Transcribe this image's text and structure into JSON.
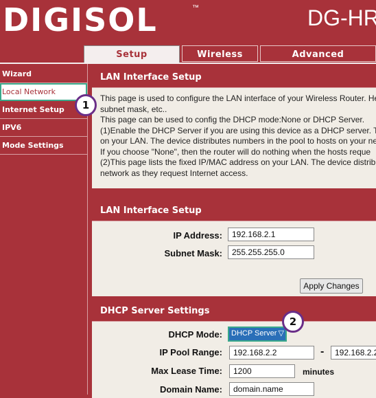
{
  "brand": {
    "logo": "DIGISOL",
    "trademark": "™",
    "model": "DG-HR"
  },
  "tabs": [
    {
      "label": "Setup",
      "active": true
    },
    {
      "label": "Wireless",
      "active": false
    },
    {
      "label": "Advanced",
      "active": false
    }
  ],
  "sidebar": {
    "items": [
      {
        "label": "Wizard"
      },
      {
        "label": "Local Network",
        "selected": true
      },
      {
        "label": "Internet Setup"
      },
      {
        "label": "IPV6"
      },
      {
        "label": "Mode Settings"
      }
    ]
  },
  "intro": {
    "title": "LAN Interface Setup",
    "lines": [
      "This page is used to configure the LAN interface of your Wireless Router. He",
      "subnet mask, etc..",
      "This page can be used to config the DHCP mode:None or DHCP Server.",
      "(1)Enable the DHCP Server if you are using this device as a DHCP server. Th",
      "on your LAN. The device distributes numbers in the pool to hosts on your ne",
      "If you choose \"None\", then the router will do nothing when the hosts reque",
      "(2)This page lists the fixed IP/MAC address on your LAN. The device distribu",
      "network as they request Internet access."
    ]
  },
  "lan": {
    "title": "LAN Interface Setup",
    "ip_label": "IP Address:",
    "ip_value": "192.168.2.1",
    "mask_label": "Subnet Mask:",
    "mask_value": "255.255.255.0",
    "apply_label": "Apply Changes"
  },
  "dhcp": {
    "title": "DHCP Server Settings",
    "mode_label": "DHCP Mode:",
    "mode_value": "DHCP Server",
    "pool_label": "IP Pool Range:",
    "pool_start": "192.168.2.2",
    "pool_sep": "-",
    "pool_end": "192.168.2.2",
    "lease_label": "Max Lease Time:",
    "lease_value": "1200",
    "lease_unit": "minutes",
    "domain_label": "Domain Name:",
    "domain_value": "domain.name"
  },
  "annotations": {
    "step1": "1",
    "step2": "2"
  },
  "colors": {
    "brand_red": "#a8323a",
    "panel_bg": "#f1ede6",
    "highlight": "#3aa88a",
    "badge_border": "#6a2e88"
  }
}
